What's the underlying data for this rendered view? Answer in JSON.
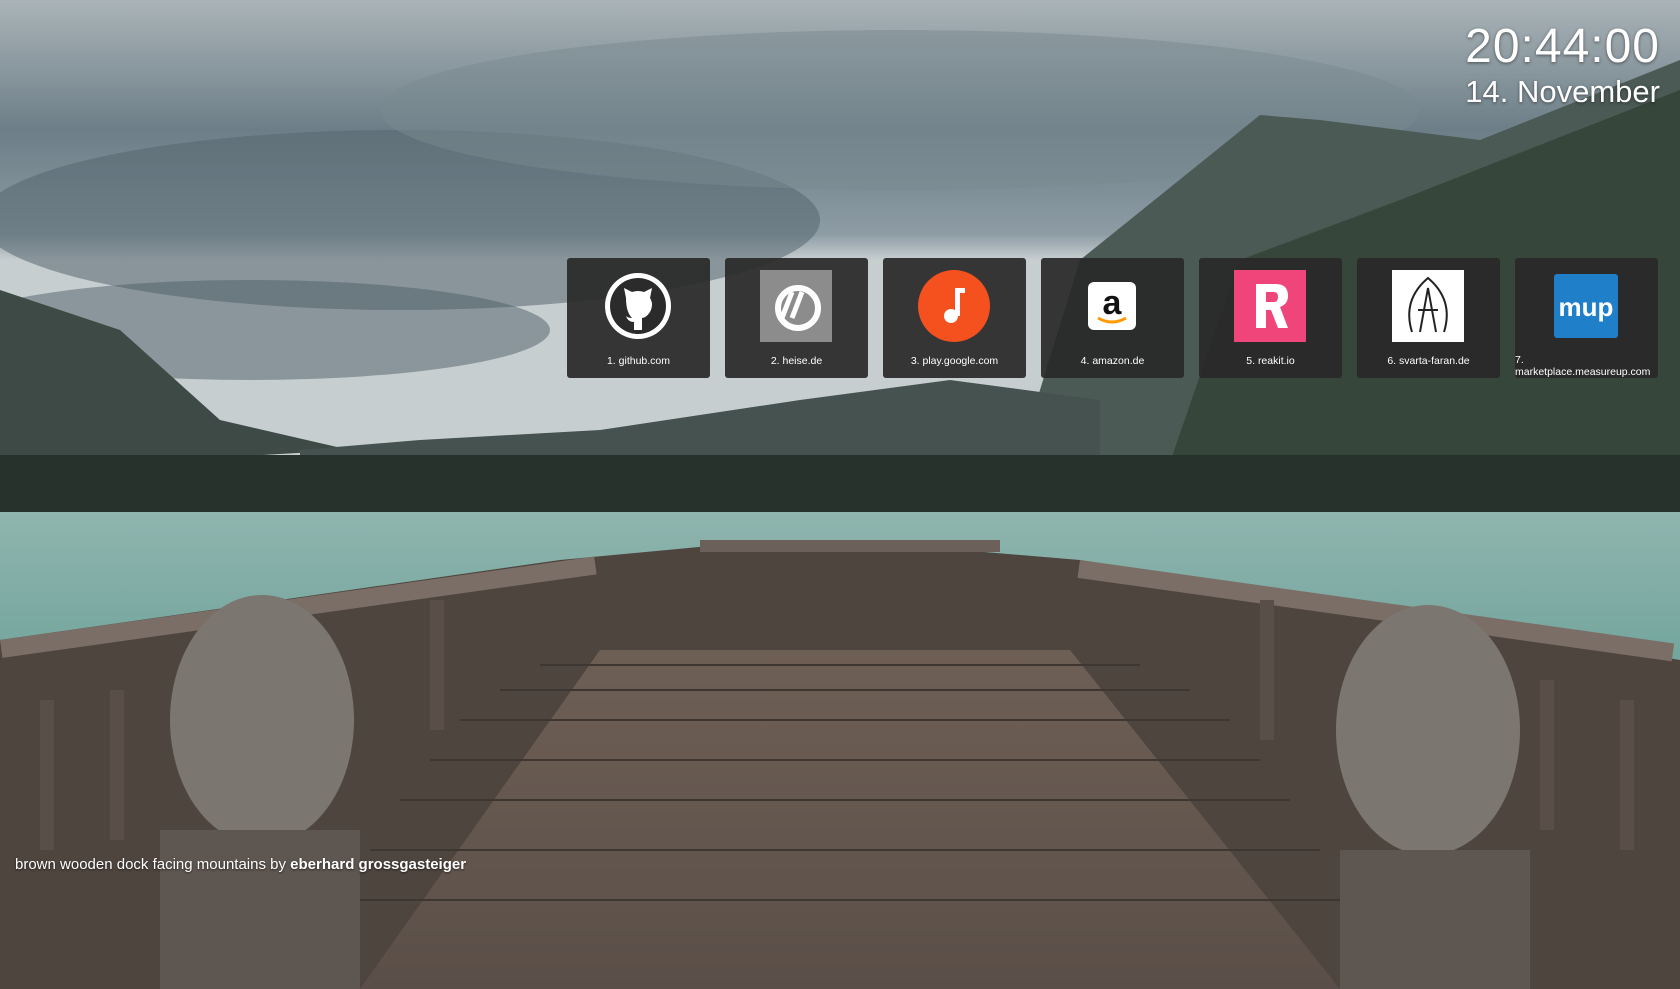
{
  "clock": {
    "time": "20:44:00",
    "date": "14. November"
  },
  "shortcuts": [
    {
      "label": "1. github.com",
      "icon": "github-icon"
    },
    {
      "label": "2. heise.de",
      "icon": "heise-icon"
    },
    {
      "label": "3. play.google.com",
      "icon": "google-play-music-icon"
    },
    {
      "label": "4. amazon.de",
      "icon": "amazon-icon"
    },
    {
      "label": "5. reakit.io",
      "icon": "reakit-icon"
    },
    {
      "label": "6. svarta-faran.de",
      "icon": "svarta-faran-icon"
    },
    {
      "label": "7. marketplace.measureup.com",
      "icon": "measureup-icon",
      "icon_text": "mup"
    }
  ],
  "credit": {
    "caption": "brown wooden dock facing mountains by ",
    "author": "eberhard grossgasteiger"
  },
  "colors": {
    "tile_bg": "#2b2b2b",
    "play_orange": "#f4511e",
    "reakit_pink": "#f0457a",
    "measureup_blue": "#1f7fc9",
    "heise_gray": "#8c8c8c"
  }
}
